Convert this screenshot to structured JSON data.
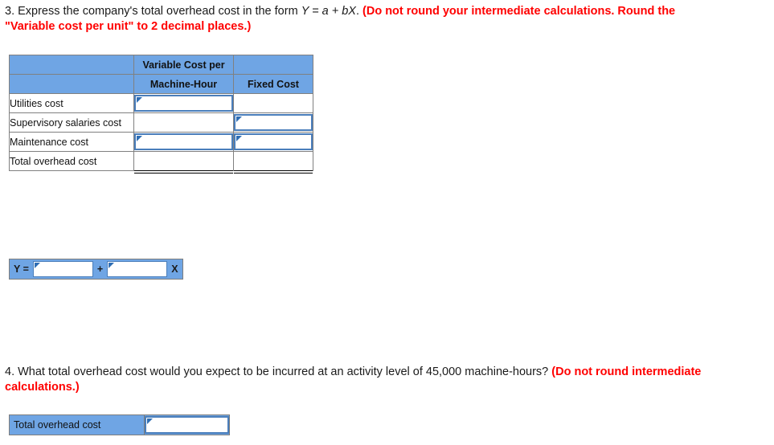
{
  "questions": {
    "q3": {
      "number": "3.",
      "text_before": " Express the company's total overhead cost in the form ",
      "formula": "Y = a + bX",
      "text_after": ". ",
      "red_line1": "(Do not round your intermediate calculations. Round the",
      "red_line2": "\"Variable cost per unit\" to 2 decimal places.)"
    },
    "q4": {
      "number": "4.",
      "text_before": " What total overhead cost would you expect to be incurred at an activity level of 45,000 machine-hours? ",
      "red_line1": "(Do not round intermediate",
      "red_line2": "calculations.)"
    }
  },
  "overhead_table": {
    "header_row1": {
      "col0": "",
      "col1": "Variable Cost per",
      "col2": ""
    },
    "header_row2": {
      "col0": "",
      "col1": "Machine-Hour",
      "col2": "Fixed Cost"
    },
    "rows": [
      {
        "label": "Utilities cost",
        "variable_cost": "",
        "fixed_cost": "",
        "variable_boxed": true,
        "fixed_boxed": false
      },
      {
        "label": "Supervisory salaries cost",
        "variable_cost": "",
        "fixed_cost": "",
        "variable_boxed": false,
        "fixed_boxed": true
      },
      {
        "label": "Maintenance cost",
        "variable_cost": "",
        "fixed_cost": "",
        "variable_boxed": true,
        "fixed_boxed": true
      },
      {
        "label": "Total overhead cost",
        "variable_cost": "",
        "fixed_cost": "",
        "variable_boxed": false,
        "fixed_boxed": false
      }
    ]
  },
  "y_equation": {
    "y_label": "Y =",
    "intercept_value": "",
    "plus_label": "+",
    "slope_value": "",
    "x_label": "X"
  },
  "q4_answer": {
    "label": "Total overhead cost",
    "value": ""
  },
  "colors": {
    "header_blue": "#6fa5e4",
    "entry_border_blue": "#4a7ebb",
    "marker_blue": "#2e6db4",
    "grid_gray": "#808080",
    "red": "#ff0000"
  }
}
